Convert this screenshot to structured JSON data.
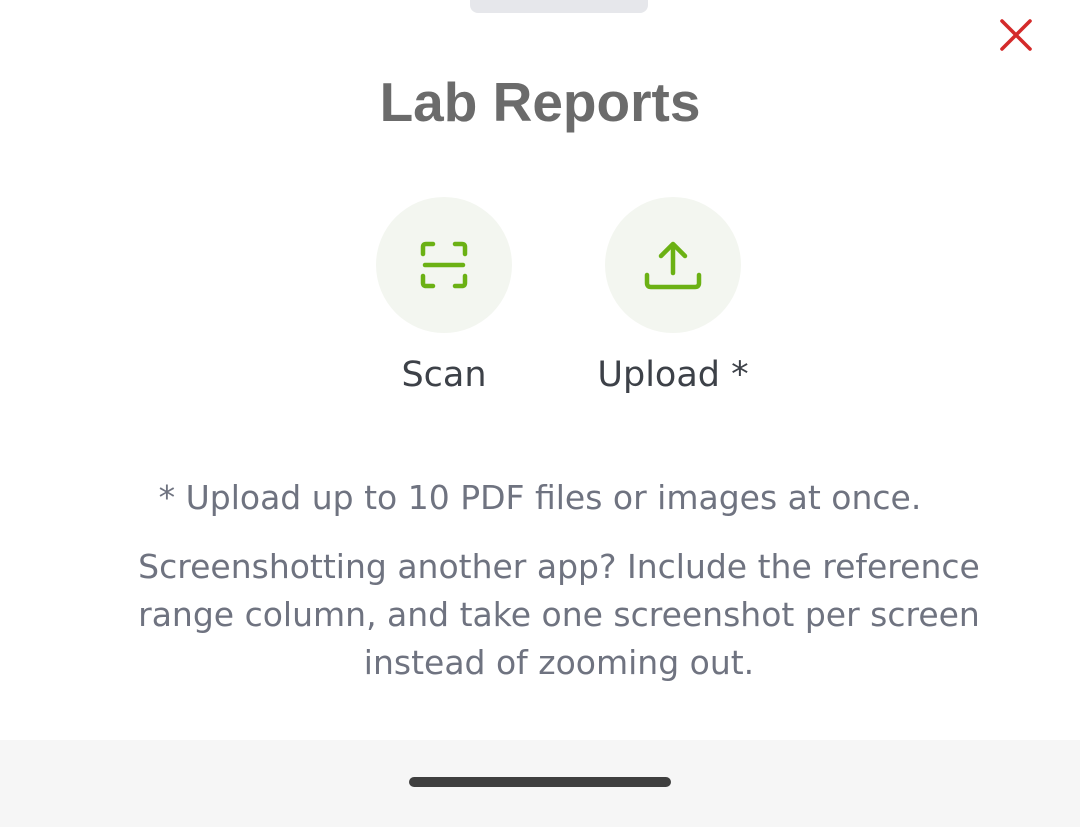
{
  "sheet": {
    "title": "Lab Reports",
    "close_icon": "close-icon",
    "colors": {
      "accent": "#6bb114",
      "close": "#d42a2a",
      "circle_bg": "#f3f6f0",
      "title": "#6b6b6b",
      "text": "#6f7380"
    }
  },
  "actions": {
    "scan": {
      "label": "Scan",
      "icon": "scan-icon"
    },
    "upload": {
      "label": "Upload *",
      "icon": "upload-icon"
    }
  },
  "note": "* Upload up to 10 PDF files or images at once.",
  "hint": "Screenshotting another app? Include the reference range column, and take one screenshot per screen instead of zooming out."
}
